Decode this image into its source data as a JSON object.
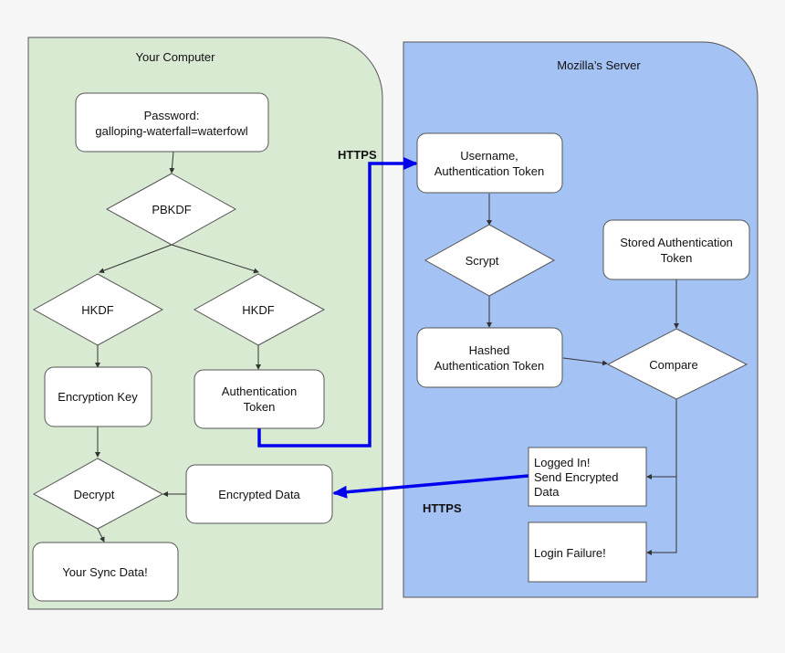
{
  "lanes": {
    "client": {
      "title": "Your Computer",
      "fill": "#d9ead3",
      "stroke": "#555555"
    },
    "server": {
      "title": "Mozilla’s Server",
      "fill": "#a4c2f4",
      "stroke": "#555555"
    }
  },
  "nodes": {
    "password": {
      "shape": "rounded-box",
      "lines": [
        "Password:",
        "galloping-waterfall=waterfowl"
      ]
    },
    "pbkdf": {
      "shape": "diamond",
      "lines": [
        "PBKDF"
      ]
    },
    "hkdf_left": {
      "shape": "diamond",
      "lines": [
        "HKDF"
      ]
    },
    "hkdf_right": {
      "shape": "diamond",
      "lines": [
        "HKDF"
      ]
    },
    "encryption_key": {
      "shape": "rounded-box",
      "lines": [
        "Encryption Key"
      ]
    },
    "auth_token": {
      "shape": "rounded-box",
      "lines": [
        "Authentication",
        "Token"
      ]
    },
    "decrypt": {
      "shape": "diamond",
      "lines": [
        "Decrypt"
      ]
    },
    "encrypted_data": {
      "shape": "rounded-box",
      "lines": [
        "Encrypted Data"
      ]
    },
    "sync_data": {
      "shape": "rounded-box",
      "lines": [
        "Your Sync Data!"
      ]
    },
    "username_token": {
      "shape": "rounded-box",
      "lines": [
        "Username,",
        "Authentication Token"
      ]
    },
    "scrypt": {
      "shape": "diamond",
      "lines": [
        "Scrypt"
      ]
    },
    "stored_token": {
      "shape": "rounded-box",
      "lines": [
        "Stored Authentication",
        "Token"
      ]
    },
    "hashed_token": {
      "shape": "rounded-box",
      "lines": [
        "Hashed",
        "Authentication Token"
      ]
    },
    "compare": {
      "shape": "diamond",
      "lines": [
        "Compare"
      ]
    },
    "logged_in": {
      "shape": "box",
      "lines": [
        "Logged In!",
        "Send Encrypted",
        "Data"
      ]
    },
    "login_failure": {
      "shape": "box",
      "lines": [
        "Login Failure!"
      ]
    }
  },
  "edges": [
    {
      "from": "password",
      "to": "pbkdf"
    },
    {
      "from": "pbkdf",
      "to": "hkdf_left"
    },
    {
      "from": "pbkdf",
      "to": "hkdf_right"
    },
    {
      "from": "hkdf_left",
      "to": "encryption_key"
    },
    {
      "from": "hkdf_right",
      "to": "auth_token"
    },
    {
      "from": "encryption_key",
      "to": "decrypt"
    },
    {
      "from": "encrypted_data",
      "to": "decrypt"
    },
    {
      "from": "decrypt",
      "to": "sync_data"
    },
    {
      "from": "auth_token",
      "to": "username_token",
      "label": "HTTPS",
      "secure": true
    },
    {
      "from": "username_token",
      "to": "scrypt"
    },
    {
      "from": "scrypt",
      "to": "hashed_token"
    },
    {
      "from": "hashed_token",
      "to": "compare"
    },
    {
      "from": "stored_token",
      "to": "compare"
    },
    {
      "from": "compare",
      "to": "logged_in"
    },
    {
      "from": "compare",
      "to": "login_failure"
    },
    {
      "from": "logged_in",
      "to": "encrypted_data",
      "label": "HTTPS",
      "secure": true
    }
  ],
  "labels": {
    "https_top": "HTTPS",
    "https_bottom": "HTTPS"
  },
  "colors": {
    "https_line": "#0000ee",
    "node_fill": "#ffffff",
    "background": "#f6f6f6"
  }
}
